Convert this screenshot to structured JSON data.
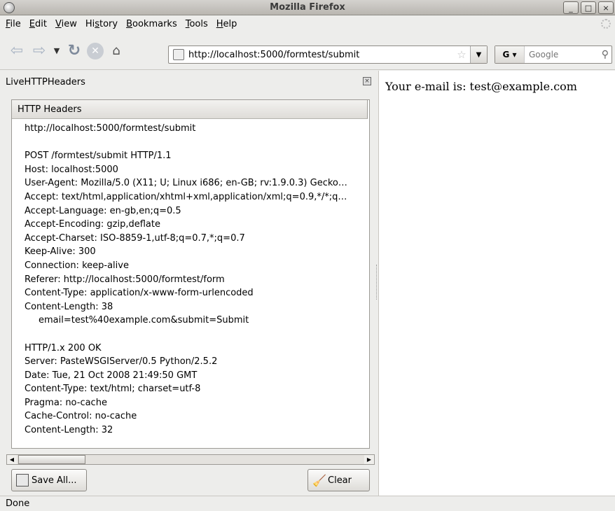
{
  "window": {
    "title": "Mozilla Firefox",
    "controls": [
      "_",
      "□",
      "×"
    ]
  },
  "menu": [
    {
      "u": "F",
      "rest": "ile"
    },
    {
      "u": "E",
      "rest": "dit"
    },
    {
      "u": "V",
      "rest": "iew"
    },
    {
      "pre": "Hi",
      "u": "s",
      "rest": "tory"
    },
    {
      "u": "B",
      "rest": "ookmarks"
    },
    {
      "u": "T",
      "rest": "ools"
    },
    {
      "u": "H",
      "rest": "elp"
    }
  ],
  "toolbar": {
    "url": "http://localhost:5000/formtest/submit",
    "search_placeholder": "Google",
    "search_engine_label": "G"
  },
  "sidebar": {
    "title": "LiveHTTPHeaders",
    "column_header": "HTTP Headers",
    "lines": [
      {
        "text": "http://localhost:5000/formtest/submit"
      },
      {
        "text": ""
      },
      {
        "text": "POST /formtest/submit HTTP/1.1"
      },
      {
        "text": "Host: localhost:5000"
      },
      {
        "text": "User-Agent: Mozilla/5.0 (X11; U; Linux i686; en-GB; rv:1.9.0.3) Gecko…"
      },
      {
        "text": "Accept: text/html,application/xhtml+xml,application/xml;q=0.9,*/*;q…"
      },
      {
        "text": "Accept-Language: en-gb,en;q=0.5"
      },
      {
        "text": "Accept-Encoding: gzip,deflate"
      },
      {
        "text": "Accept-Charset: ISO-8859-1,utf-8;q=0.7,*;q=0.7"
      },
      {
        "text": "Keep-Alive: 300"
      },
      {
        "text": "Connection: keep-alive"
      },
      {
        "text": "Referer: http://localhost:5000/formtest/form"
      },
      {
        "text": "Content-Type: application/x-www-form-urlencoded"
      },
      {
        "text": "Content-Length: 38"
      },
      {
        "text": "email=test%40example.com&submit=Submit",
        "indent": true
      },
      {
        "text": ""
      },
      {
        "text": "HTTP/1.x 200 OK"
      },
      {
        "text": "Server: PasteWSGIServer/0.5 Python/2.5.2"
      },
      {
        "text": "Date: Tue, 21 Oct 2008 21:49:50 GMT"
      },
      {
        "text": "Content-Type: text/html; charset=utf-8"
      },
      {
        "text": "Pragma: no-cache"
      },
      {
        "text": "Cache-Control: no-cache"
      },
      {
        "text": "Content-Length: 32"
      }
    ],
    "save_all_label": "Save All...",
    "clear_label": "Clear"
  },
  "content": {
    "text": "Your e-mail is: test@example.com"
  },
  "status": {
    "text": "Done"
  }
}
